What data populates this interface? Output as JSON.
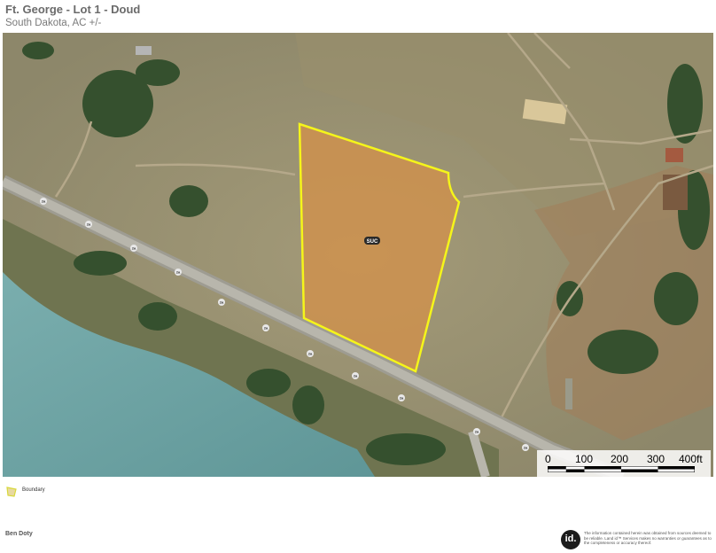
{
  "header": {
    "title": "Ft. George - Lot 1 - Doud",
    "subtitle": "South Dakota,  AC +/-"
  },
  "map": {
    "parcel_label": "SUC",
    "road_shield_label": "2a",
    "boundary_color": "#f5f51a",
    "parcel_fill": "#d2914a",
    "water_color": "#6fa3a4",
    "scale": {
      "ticks": [
        "0",
        "100",
        "200",
        "300",
        "400ft"
      ]
    }
  },
  "legend": {
    "boundary_label": "Boundary",
    "boundary_icon": "boundary-polygon-icon"
  },
  "footer": {
    "author": "Ben Doty",
    "logo_text": "id.",
    "disclaimer": "The information contained herein was obtained from sources deemed to be reliable. Land id™ Services makes no warranties or guarantees as to the completeness or accuracy thereof."
  }
}
